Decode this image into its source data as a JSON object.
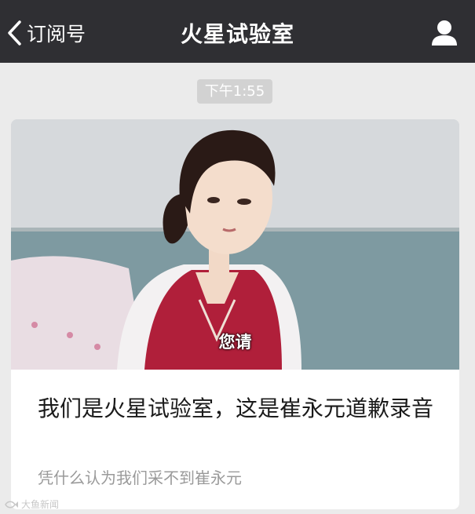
{
  "navbar": {
    "back_label": "订阅号",
    "title": "火星试验室",
    "back_icon": "chevron-left-icon",
    "profile_icon": "person-icon",
    "background": "#2f2f33"
  },
  "timestamp": "下午1:55",
  "article": {
    "cover_caption": "您请",
    "title": "我们是火星试验室，这是崔永元道歉录音",
    "digest": "凭什么认为我们采不到崔永元"
  },
  "watermark": {
    "text": "大鱼新闻"
  }
}
